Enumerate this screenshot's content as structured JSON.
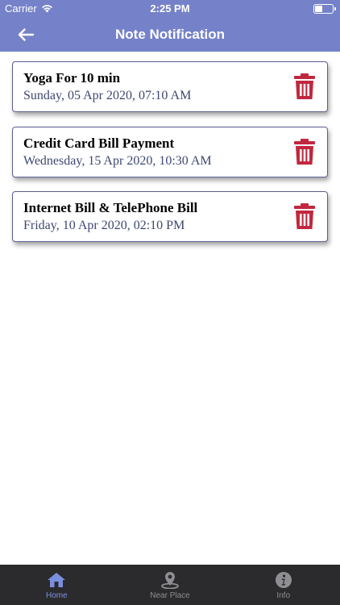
{
  "status_bar": {
    "carrier": "Carrier",
    "time": "2:25 PM"
  },
  "nav": {
    "title": "Note Notification",
    "back_icon": "arrow-left-icon"
  },
  "notes": [
    {
      "title": "Yoga For 10 min",
      "date": "Sunday, 05 Apr 2020, 07:10 AM"
    },
    {
      "title": "Credit Card Bill Payment",
      "date": "Wednesday, 15 Apr 2020, 10:30 AM"
    },
    {
      "title": "Internet Bill & TelePhone Bill",
      "date": "Friday, 10 Apr 2020, 02:10 PM"
    }
  ],
  "tabs": [
    {
      "label": "Home",
      "icon": "home-icon",
      "active": true
    },
    {
      "label": "Near Place",
      "icon": "location-pin-icon",
      "active": false
    },
    {
      "label": "Info",
      "icon": "info-icon",
      "active": false
    }
  ],
  "colors": {
    "header": "#7582c9",
    "delete": "#c0283f",
    "tab_active": "#7b8fe0",
    "tab_inactive": "#8e8e93",
    "tab_bar": "#2b2b2e"
  }
}
